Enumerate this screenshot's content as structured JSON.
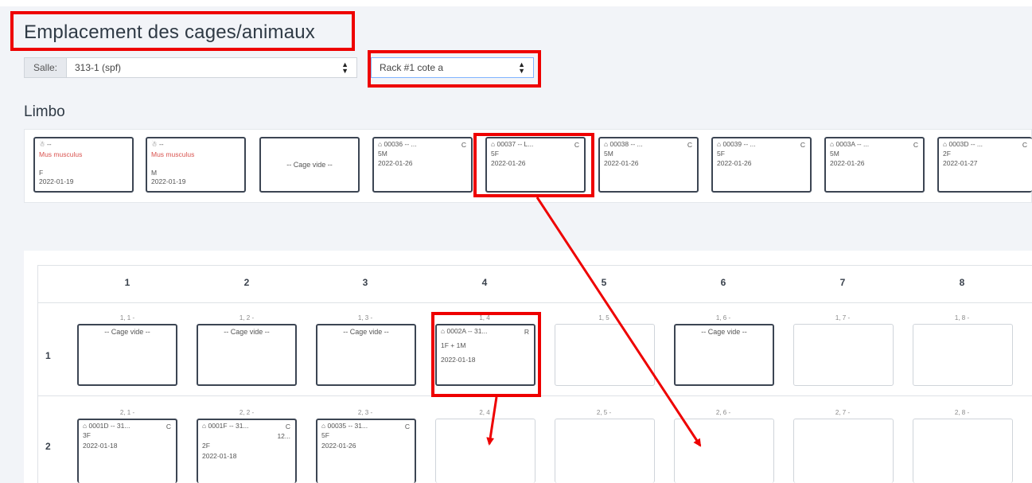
{
  "page": {
    "title": "Emplacement des cages/animaux"
  },
  "filters": {
    "salle_label": "Salle:",
    "salle_value": "313-1 (spf)",
    "rack_value": "Rack #1 cote a"
  },
  "limbo": {
    "title": "Limbo",
    "cages": [
      {
        "id": "☃ --",
        "species": "Mus musculus",
        "sex": "F",
        "date": "2022-01-19"
      },
      {
        "id": "☃ --",
        "species": "Mus musculus",
        "sex": "M",
        "date": "2022-01-19"
      },
      {
        "empty": "-- Cage vide --"
      },
      {
        "id": "00036 -- ...",
        "tag": "C",
        "count": "5M",
        "date": "2022-01-26"
      },
      {
        "id": "00037 -- L...",
        "tag": "C",
        "count": "5F",
        "date": "2022-01-26"
      },
      {
        "id": "00038 -- ...",
        "tag": "C",
        "count": "5M",
        "date": "2022-01-26"
      },
      {
        "id": "00039 -- ...",
        "tag": "C",
        "count": "5F",
        "date": "2022-01-26"
      },
      {
        "id": "0003A -- ...",
        "tag": "C",
        "count": "5M",
        "date": "2022-01-26"
      },
      {
        "id": "0003D -- ...",
        "tag": "C",
        "count": "2F",
        "date": "2022-01-27"
      }
    ]
  },
  "rack": {
    "columns": [
      "1",
      "2",
      "3",
      "4",
      "5",
      "6",
      "7",
      "8"
    ],
    "rows": [
      {
        "label": "1",
        "slots": [
          {
            "pos": "1, 1 -",
            "empty": "-- Cage vide --"
          },
          {
            "pos": "1, 2 -",
            "empty": "-- Cage vide --"
          },
          {
            "pos": "1, 3 -",
            "empty": "-- Cage vide --"
          },
          {
            "pos": "1, 4",
            "id": "0002A -- 31...",
            "tag": "R",
            "count": "1F + 1M",
            "date": "2022-01-18"
          },
          {
            "pos": "1, 5"
          },
          {
            "pos": "1, 6 -",
            "empty": "-- Cage vide --"
          },
          {
            "pos": "1, 7 -"
          },
          {
            "pos": "1, 8 -"
          }
        ]
      },
      {
        "label": "2",
        "slots": [
          {
            "pos": "2, 1 -",
            "id": "0001D -- 31...",
            "tag": "C",
            "count": "3F",
            "date": "2022-01-18"
          },
          {
            "pos": "2, 2 -",
            "id": "0001F -- 31...",
            "tag": "C",
            "extra": "12...",
            "count": "2F",
            "date": "2022-01-18"
          },
          {
            "pos": "2, 3 -",
            "id": "00035 -- 31...",
            "tag": "C",
            "count": "5F",
            "date": "2022-01-26"
          },
          {
            "pos": "2, 4"
          },
          {
            "pos": "2, 5 -"
          },
          {
            "pos": "2, 6 -"
          },
          {
            "pos": "2, 7 -"
          },
          {
            "pos": "2, 8 -"
          }
        ]
      }
    ]
  },
  "icons": {
    "cage_icon": "cage-icon",
    "select_caret": "sort-caret-icon"
  },
  "colors": {
    "annotation_red": "#ee0000",
    "species_red": "#d9534f",
    "cage_border": "#3c4553",
    "select_focus": "#80b3ff"
  }
}
